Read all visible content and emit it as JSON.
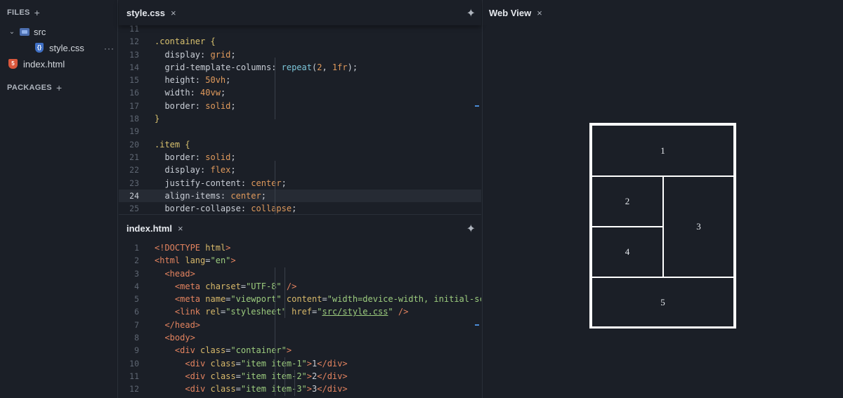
{
  "sidebar": {
    "files_label": "FILES",
    "packages_label": "PACKAGES",
    "plus": "+",
    "folder": {
      "name": "src",
      "chevron": "⌄",
      "icon": "folder-icon"
    },
    "files": [
      {
        "name": "style.css",
        "icon": "css-file-icon"
      },
      {
        "name": "index.html",
        "icon": "html-file-icon"
      }
    ],
    "more": "···"
  },
  "css_pane": {
    "tab": "style.css",
    "close": "×",
    "lines": [
      "11",
      "12",
      "13",
      "14",
      "15",
      "16",
      "17",
      "18",
      "19",
      "20",
      "21",
      "22",
      "23",
      "24",
      "25"
    ]
  },
  "html_pane": {
    "tab": "index.html",
    "close": "×",
    "lines": [
      "1",
      "2",
      "3",
      "4",
      "5",
      "6",
      "7",
      "8",
      "9",
      "10",
      "11",
      "12"
    ]
  },
  "webview": {
    "tab": "Web View",
    "close": "×",
    "cells": [
      "1",
      "2",
      "3",
      "4",
      "5"
    ]
  },
  "colors": {
    "background": "#1b1f27",
    "accent_play": "#5fbf5f",
    "gutter_mark": "#4b8bd6"
  }
}
